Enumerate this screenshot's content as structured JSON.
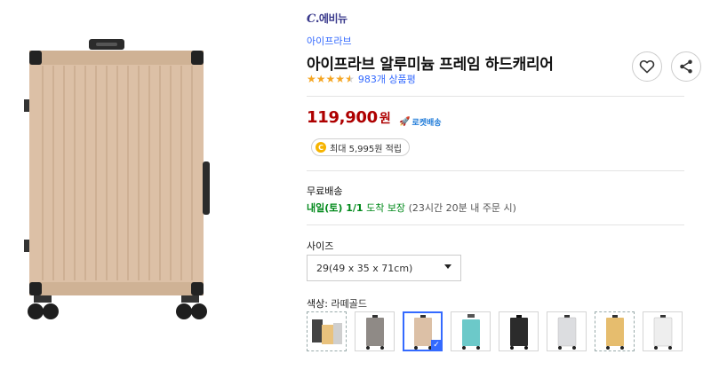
{
  "product": {
    "brand_logo": "C.에비뉴",
    "brand_logo_mark": "C",
    "brand_logo_text": ".에비뉴",
    "brand_link": "아이프라브",
    "title": "아이프라브 알루미늄 프레임 하드캐리어",
    "rating": 4.5,
    "review_count": "983개 상품평",
    "price": "119,900",
    "price_unit": "원",
    "rocket_label": "로켓배송",
    "cashback_coin": "C",
    "cashback_text": "최대 5,995원 적립"
  },
  "shipping": {
    "label": "무료배송",
    "arrival_day": "내일(토) 1/1",
    "arrival_guarantee": "도착 보장",
    "order_deadline": "(23시간 20분 내 주문 시)"
  },
  "options": {
    "size_label": "사이즈",
    "size_selected": "29(49 x 35 x 71cm)",
    "color_label": "색상: ",
    "color_selected": "라떼골드",
    "swatches": [
      {
        "name": "multi",
        "color": "#e9c27d"
      },
      {
        "name": "gray",
        "color": "#8f8a86"
      },
      {
        "name": "latte-gold",
        "color": "#dcc0a6",
        "selected": true
      },
      {
        "name": "mint",
        "color": "#6cc9c9"
      },
      {
        "name": "black",
        "color": "#2b2b2b"
      },
      {
        "name": "silver",
        "color": "#dcdde0"
      },
      {
        "name": "yellow",
        "color": "#e6bd6e"
      },
      {
        "name": "white",
        "color": "#eeeeee"
      }
    ]
  },
  "colors": {
    "price": "#ae0000",
    "link": "#346aff",
    "green": "#00891a",
    "star": "#f5a623"
  }
}
